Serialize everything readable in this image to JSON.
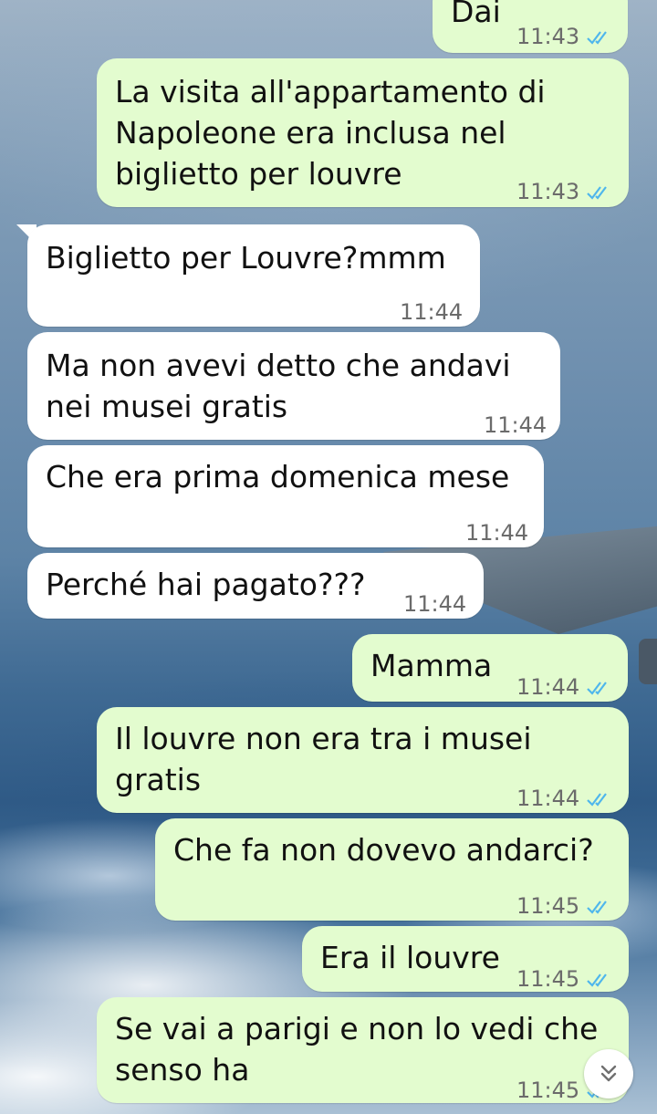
{
  "theme": {
    "outgoing_bubble": "#e3fccf",
    "incoming_bubble": "#ffffff",
    "read_tick": "#4fb6ec",
    "time_text": "#6b6b6b"
  },
  "messages": [
    {
      "direction": "out",
      "text": "Dai",
      "time": "11:43",
      "status": "read-double-tick-icon"
    },
    {
      "direction": "out",
      "text": "La visita all'appartamento di\nNapoleone era inclusa nel\nbiglietto per louvre",
      "time": "11:43",
      "status": "read-double-tick-icon"
    },
    {
      "direction": "in",
      "text": "Biglietto per Louvre?mmm",
      "time": "11:44"
    },
    {
      "direction": "in",
      "text": "Ma non avevi detto che andavi\nnei musei gratis",
      "time": "11:44"
    },
    {
      "direction": "in",
      "text": "Che era prima domenica mese",
      "time": "11:44"
    },
    {
      "direction": "in",
      "text": "Perché hai pagato???",
      "time": "11:44"
    },
    {
      "direction": "out",
      "text": "Mamma",
      "time": "11:44",
      "status": "read-double-tick-icon"
    },
    {
      "direction": "out",
      "text": "Il louvre non era tra i musei\ngratis",
      "time": "11:44",
      "status": "read-double-tick-icon"
    },
    {
      "direction": "out",
      "text": "Che fa non dovevo andarci?",
      "time": "11:45",
      "status": "read-double-tick-icon"
    },
    {
      "direction": "out",
      "text": "Era il louvre",
      "time": "11:45",
      "status": "read-double-tick-icon"
    },
    {
      "direction": "out",
      "text": "Se vai a parigi e non lo vedi che\nsenso ha",
      "time": "11:45",
      "status": "read-double-tick-icon"
    }
  ],
  "scroll_button": {
    "icon": "double-chevron-down-icon"
  }
}
